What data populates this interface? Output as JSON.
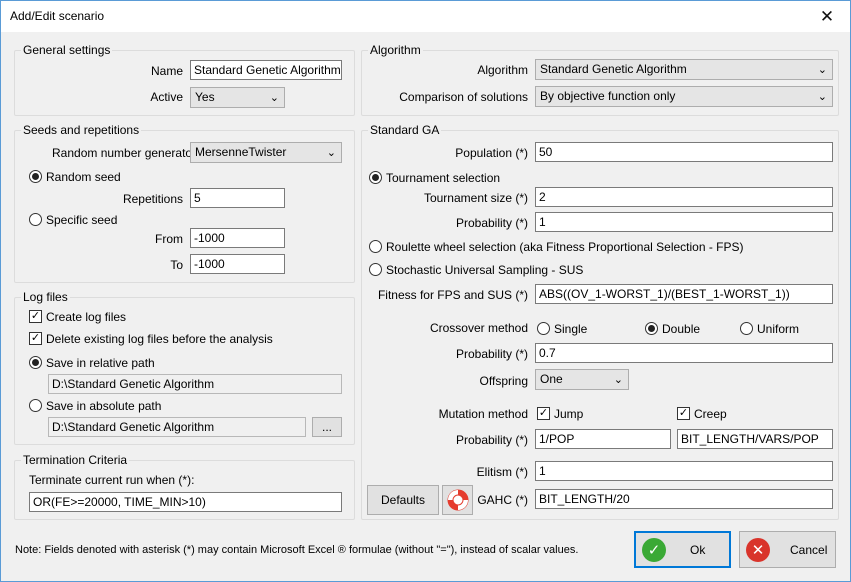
{
  "window": {
    "title": "Add/Edit scenario",
    "close_glyph": "✕"
  },
  "general": {
    "legend": "General settings",
    "name_label": "Name",
    "name_value": "Standard Genetic Algorithm",
    "active_label": "Active",
    "active_value": "Yes"
  },
  "seeds": {
    "legend": "Seeds and repetitions",
    "rng_label": "Random number generator",
    "rng_value": "MersenneTwister",
    "random_seed_label": "Random seed",
    "repetitions_label": "Repetitions",
    "repetitions_value": "5",
    "specific_seed_label": "Specific seed",
    "from_label": "From",
    "from_value": "-1000",
    "to_label": "To",
    "to_value": "-1000"
  },
  "logs": {
    "legend": "Log files",
    "create_label": "Create log files",
    "delete_label": "Delete existing log files before the analysis",
    "relative_label": "Save in relative path",
    "relative_value": "D:\\Standard Genetic Algorithm",
    "absolute_label": "Save in absolute path",
    "absolute_value": "D:\\Standard Genetic Algorithm",
    "browse_label": "..."
  },
  "termination": {
    "legend": "Termination Criteria",
    "label": "Terminate current run when (*):",
    "value": "OR(FE>=20000, TIME_MIN>10)"
  },
  "algorithm": {
    "legend": "Algorithm",
    "algorithm_label": "Algorithm",
    "algorithm_value": "Standard Genetic Algorithm",
    "comparison_label": "Comparison of solutions",
    "comparison_value": "By objective function only"
  },
  "ga": {
    "legend": "Standard GA",
    "population_label": "Population (*)",
    "population_value": "50",
    "tournament_label": "Tournament selection",
    "tsize_label": "Tournament size (*)",
    "tsize_value": "2",
    "tprob_label": "Probability (*)",
    "tprob_value": "1",
    "roulette_label": "Roulette wheel selection (aka Fitness Proportional Selection - FPS)",
    "sus_label": "Stochastic Universal Sampling - SUS",
    "fitness_label": "Fitness for FPS and SUS (*)",
    "fitness_value": "ABS((OV_1-WORST_1)/(BEST_1-WORST_1))",
    "crossover_label": "Crossover method",
    "single_label": "Single",
    "double_label": "Double",
    "uniform_label": "Uniform",
    "cprob_label": "Probability (*)",
    "cprob_value": "0.7",
    "offspring_label": "Offspring",
    "offspring_value": "One",
    "mutation_label": "Mutation method",
    "jump_label": "Jump",
    "creep_label": "Creep",
    "mprob_label": "Probability (*)",
    "mprob_jump_value": "1/POP",
    "mprob_creep_value": "BIT_LENGTH/VARS/POP",
    "elitism_label": "Elitism (*)",
    "elitism_value": "1",
    "gahc_label": "GAHC (*)",
    "gahc_value": "BIT_LENGTH/20"
  },
  "footer": {
    "defaults_label": "Defaults",
    "note": "Note: Fields denoted with asterisk (*) may contain Microsoft Excel ® formulae (without \"=\"), instead of scalar values.",
    "ok_label": "Ok",
    "cancel_label": "Cancel"
  },
  "colors": {
    "ok_green": "#3aa935",
    "cancel_red": "#d9342b",
    "lifebuoy_red": "#e53c2e",
    "accent": "#0078d7"
  }
}
